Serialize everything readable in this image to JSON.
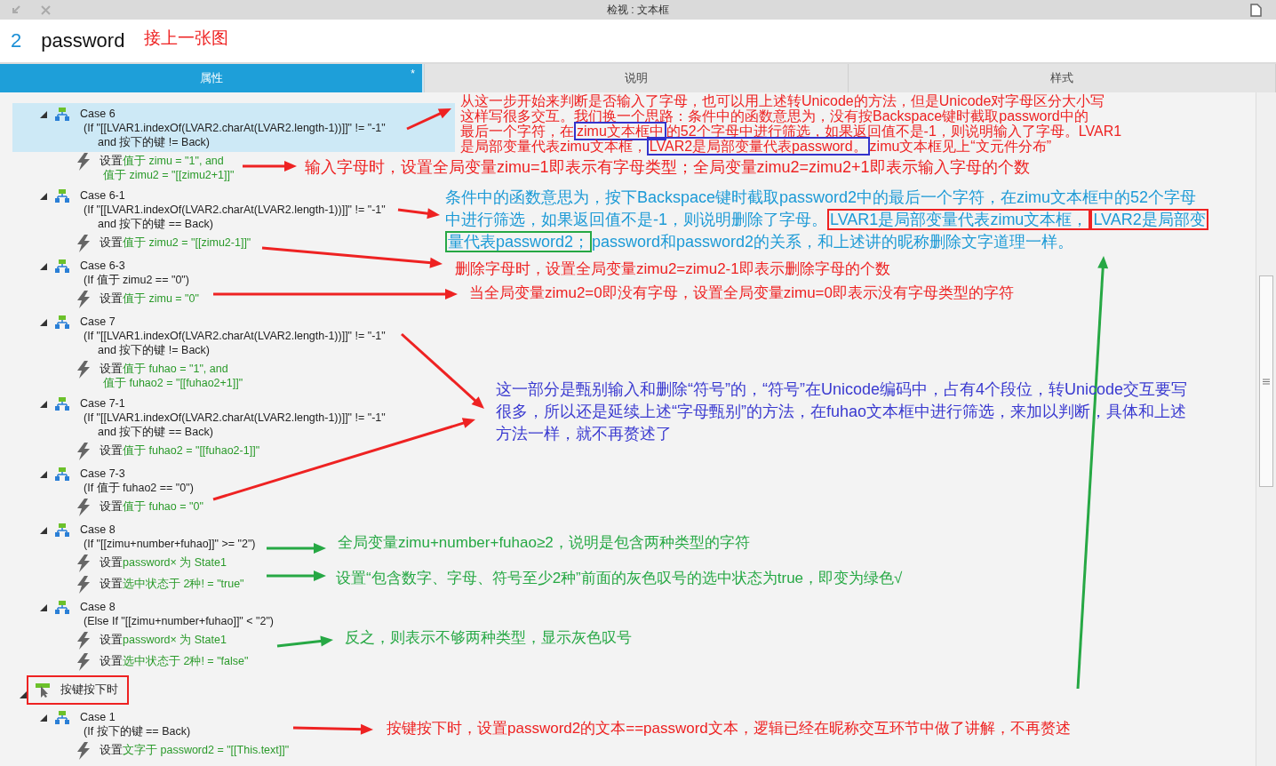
{
  "window": {
    "title": "检视 : 文本框"
  },
  "header": {
    "number": "2",
    "name": "password",
    "note": "接上一张图"
  },
  "tabs": [
    {
      "label": "属性",
      "selected": true,
      "marker": "*"
    },
    {
      "label": "说明",
      "selected": false
    },
    {
      "label": "样式",
      "selected": false
    }
  ],
  "cases": [
    {
      "title": "Case 6",
      "selected": true,
      "expanded": true,
      "condition": [
        "(If \"[[LVAR1.indexOf(LVAR2.charAt(LVAR2.length-1))]]\" != \"-1\"",
        "and 按下的键 != Back)"
      ],
      "actions": [
        {
          "verb": "设置",
          "lines": [
            "值于 zimu = \"1\", and",
            "值于 zimu2 = \"[[zimu2+1]]\""
          ]
        }
      ]
    },
    {
      "title": "Case 6-1",
      "selected": false,
      "expanded": true,
      "condition": [
        "(If \"[[LVAR1.indexOf(LVAR2.charAt(LVAR2.length-1))]]\" != \"-1\"",
        "and 按下的键 == Back)"
      ],
      "actions": [
        {
          "verb": "设置",
          "lines": [
            "值于 zimu2 = \"[[zimu2-1]]\""
          ]
        }
      ]
    },
    {
      "title": "Case 6-3",
      "selected": false,
      "expanded": true,
      "condition": [
        "(If 值于 zimu2 == \"0\")"
      ],
      "actions": [
        {
          "verb": "设置",
          "lines": [
            "值于 zimu = \"0\""
          ]
        }
      ]
    },
    {
      "title": "Case 7",
      "selected": false,
      "expanded": true,
      "condition": [
        "(If \"[[LVAR1.indexOf(LVAR2.charAt(LVAR2.length-1))]]\" != \"-1\"",
        "and 按下的键 != Back)"
      ],
      "actions": [
        {
          "verb": "设置",
          "lines": [
            "值于 fuhao = \"1\", and",
            "值于 fuhao2 = \"[[fuhao2+1]]\""
          ]
        }
      ]
    },
    {
      "title": "Case 7-1",
      "selected": false,
      "expanded": true,
      "condition": [
        "(If \"[[LVAR1.indexOf(LVAR2.charAt(LVAR2.length-1))]]\" != \"-1\"",
        "and 按下的键 == Back)"
      ],
      "actions": [
        {
          "verb": "设置",
          "lines": [
            "值于 fuhao2 = \"[[fuhao2-1]]\""
          ]
        }
      ]
    },
    {
      "title": "Case 7-3",
      "selected": false,
      "expanded": true,
      "condition": [
        "(If 值于 fuhao2 == \"0\")"
      ],
      "actions": [
        {
          "verb": "设置",
          "lines": [
            "值于 fuhao = \"0\""
          ]
        }
      ]
    },
    {
      "title": "Case 8",
      "selected": false,
      "expanded": true,
      "condition": [
        "(If \"[[zimu+number+fuhao]]\" >= \"2\")"
      ],
      "actions": [
        {
          "verb": "设置",
          "lines": [
            "password× 为 State1"
          ]
        },
        {
          "verb": "设置",
          "lines": [
            "选中状态于 2种!  = \"true\""
          ]
        }
      ]
    },
    {
      "title": "Case 8",
      "selected": false,
      "expanded": true,
      "condition": [
        "(Else If \"[[zimu+number+fuhao]]\" < \"2\")"
      ],
      "actions": [
        {
          "verb": "设置",
          "lines": [
            "password× 为 State1"
          ]
        },
        {
          "verb": "设置",
          "lines": [
            "选中状态于 2种!  = \"false\""
          ]
        }
      ]
    }
  ],
  "event": {
    "label": "按键按下时",
    "expanded": true,
    "highlighted": true,
    "cases": [
      {
        "title": "Case 1",
        "selected": false,
        "expanded": true,
        "condition": [
          "(If 按下的键 == Back)"
        ],
        "actions": [
          {
            "verb": "设置",
            "lines": [
              "文字于 password2 = \"[[This.text]]\""
            ]
          }
        ]
      }
    ]
  },
  "annotations": [
    {
      "color": "#ee2222",
      "lines": [
        [
          {
            "text": "从这一步开始来判断是否输入了字母，也可以用上述转Unicode的方法，但是Unicode对字母区分大小写"
          }
        ],
        [
          {
            "text": "这样写很多交互。我们换一个思路：条件中的函数意思为，没有按Backspace键时截取password中的"
          }
        ],
        [
          {
            "text": "最后一个字符，在"
          },
          {
            "text": "zimu文本框中",
            "color": "#3333cc"
          },
          {
            "text": "的52个字母中进行筛选，如果返回值不是-1，则说明输入了字母。LVAR1"
          }
        ],
        [
          {
            "text": "是局部变量代表zimu文本框，"
          },
          {
            "text": "LVAR2是局部变量代表password。",
            "color": "#3333cc"
          },
          {
            "text": "zimu文本框见上“文元件分布”"
          }
        ]
      ]
    },
    {
      "color": "#ee2222",
      "lines": [
        [
          {
            "text": "输入字母时，设置全局变量zimu=1即表示有字母类型；全局变量zimu2=zimu2+1即表示输入字母的个数"
          }
        ]
      ]
    },
    {
      "color": "#1c9ad6",
      "lines": [
        [
          {
            "text": "条件中的函数意思为，按下Backspace键时截取password2中的最后一个字符，在zimu文本框中的52个字母"
          }
        ],
        [
          {
            "text": "中进行筛选，如果返回值不是-1，则说明删除了字母。"
          },
          {
            "text": "LVAR1是局部变量代表zimu文本框，",
            "color": "#ee2222"
          },
          {
            "text": "LVAR2是局部变",
            "color": "#ee2222"
          }
        ],
        [
          {
            "text": "量代表password2；",
            "color": "#26a844"
          },
          {
            "text": "password和password2的关系，和上述讲的昵称删除文字道理一样。"
          }
        ]
      ]
    },
    {
      "color": "#ee2222",
      "lines": [
        [
          {
            "text": "删除字母时，设置全局变量zimu2=zimu2-1即表示删除字母的个数"
          }
        ]
      ]
    },
    {
      "color": "#ee2222",
      "lines": [
        [
          {
            "text": "当全局变量zimu2=0即没有字母，设置全局变量zimu=0即表示没有字母类型的字符"
          }
        ]
      ]
    },
    {
      "color": "#3a3ad0",
      "lines": [
        [
          {
            "text": "这一部分是甄别输入和删除“符号”的，“符号”在Unicode编码中，占有4个段位，转Unicode交互要写"
          }
        ],
        [
          {
            "text": "很多，所以还是延续上述“字母甄别”的方法，在fuhao文本框中进行筛选，来加以判断，具体和上述"
          }
        ],
        [
          {
            "text": "方法一样，就不再赘述了"
          }
        ]
      ]
    },
    {
      "color": "#26a844",
      "lines": [
        [
          {
            "text": "全局变量zimu+number+fuhao≥2，说明是包含两种类型的字符"
          }
        ]
      ]
    },
    {
      "color": "#26a844",
      "lines": [
        [
          {
            "text": "设置“包含数字、字母、符号至少2种”前面的灰色叹号的选中状态为true，即变为绿色√"
          }
        ]
      ]
    },
    {
      "color": "#26a844",
      "lines": [
        [
          {
            "text": "反之，则表示不够两种类型，显示灰色叹号"
          }
        ]
      ]
    },
    {
      "color": "#ee2222",
      "lines": [
        [
          {
            "text": "按键按下时，设置password2的文本==password文本，逻辑已经在昵称交互环节中做了讲解，不再赘述"
          }
        ]
      ]
    }
  ]
}
